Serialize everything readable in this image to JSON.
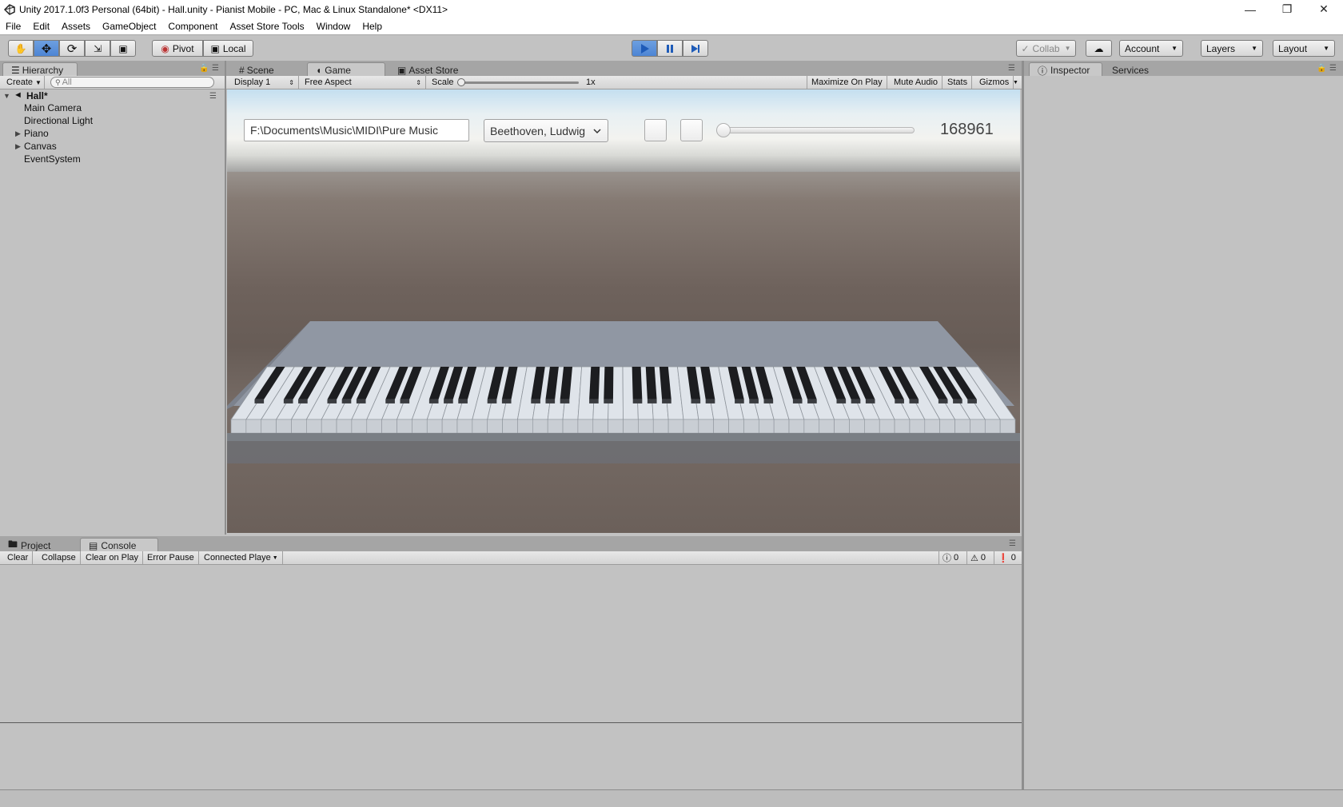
{
  "window": {
    "title": "Unity 2017.1.0f3 Personal (64bit) - Hall.unity - Pianist Mobile - PC, Mac & Linux Standalone* <DX11>",
    "controls": [
      "minimize",
      "restore",
      "close"
    ]
  },
  "menu": [
    "File",
    "Edit",
    "Assets",
    "GameObject",
    "Component",
    "Asset Store Tools",
    "Window",
    "Help"
  ],
  "toolbar": {
    "tools": [
      "hand-icon",
      "move-icon",
      "rotate-icon",
      "scale-icon",
      "rect-tool-icon"
    ],
    "pivot": "Pivot",
    "local": "Local",
    "collab": "Collab",
    "account": "Account",
    "layers": "Layers",
    "layout": "Layout"
  },
  "hierarchy": {
    "tab": "Hierarchy",
    "create": "Create",
    "search_placeholder": "All",
    "scene": "Hall*",
    "items": [
      {
        "label": "Main Camera",
        "expandable": false
      },
      {
        "label": "Directional Light",
        "expandable": false
      },
      {
        "label": "Piano",
        "expandable": true
      },
      {
        "label": "Canvas",
        "expandable": true
      },
      {
        "label": "EventSystem",
        "expandable": false
      }
    ]
  },
  "center_tabs": [
    "Scene",
    "Game",
    "Asset Store"
  ],
  "game_bar": {
    "display": "Display 1",
    "aspect": "Free Aspect",
    "scale_label": "Scale",
    "scale_value": "1x",
    "scale_level": 0,
    "maximize": "Maximize On Play",
    "mute": "Mute Audio",
    "stats": "Stats",
    "gizmos": "Gizmos"
  },
  "game": {
    "path_value": "F:\\Documents\\Music\\MIDI\\Pure Music",
    "composer": "Beethoven, Ludwig",
    "slider_level": 0,
    "counter": "168961"
  },
  "right_tabs": [
    "Inspector",
    "Services"
  ],
  "bottom_tabs": [
    "Project",
    "Console"
  ],
  "console_bar": {
    "clear": "Clear",
    "collapse": "Collapse",
    "clear_on_play": "Clear on Play",
    "error_pause": "Error Pause",
    "connected": "Connected Playe",
    "info_count": "0",
    "warn_count": "0",
    "error_count": "0"
  },
  "colors": {
    "play_active": "#4d85d4",
    "panel_bg": "#c2c2c2"
  }
}
